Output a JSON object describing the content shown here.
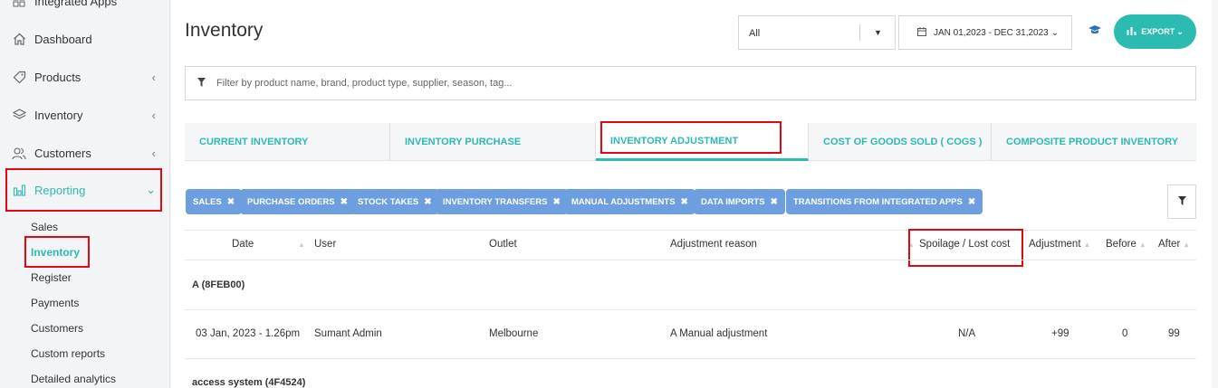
{
  "sidebar": {
    "items": [
      {
        "label": "Integrated Apps",
        "icon": "grid-icon"
      },
      {
        "label": "Dashboard",
        "icon": "home-icon"
      },
      {
        "label": "Products",
        "icon": "tag-icon"
      },
      {
        "label": "Inventory",
        "icon": "layers-icon"
      },
      {
        "label": "Customers",
        "icon": "users-icon"
      },
      {
        "label": "Reporting",
        "icon": "bar-chart-icon"
      }
    ],
    "reporting_sub": [
      "Sales",
      "Inventory",
      "Register",
      "Payments",
      "Customers",
      "Custom reports",
      "Detailed analytics"
    ]
  },
  "header": {
    "title": "Inventory",
    "outlet_select": "All",
    "date_range": "JAN 01,2023 - DEC 31,2023",
    "export_label": "EXPORT"
  },
  "filter": {
    "placeholder": "Filter by product name, brand, product type, supplier, season, tag..."
  },
  "tabs": [
    "CURRENT INVENTORY",
    "INVENTORY PURCHASE",
    "INVENTORY ADJUSTMENT",
    "COST OF GOODS SOLD ( COGS )",
    "COMPOSITE PRODUCT INVENTORY"
  ],
  "chips": [
    "SALES",
    "PURCHASE ORDERS",
    "STOCK TAKES",
    "INVENTORY TRANSFERS",
    "MANUAL ADJUSTMENTS",
    "DATA IMPORTS",
    "TRANSITIONS FROM INTEGRATED APPS"
  ],
  "table": {
    "columns": [
      "Date",
      "User",
      "Outlet",
      "Adjustment reason",
      "Spoilage / Lost cost",
      "Adjustment",
      "Before",
      "After"
    ],
    "groups": [
      {
        "name": "A (8FEB00)",
        "rows": [
          {
            "date": "03 Jan, 2023 - 1.26pm",
            "user": "Sumant Admin",
            "outlet": "Melbourne",
            "reason": "A Manual adjustment",
            "spoilage": "N/A",
            "adjustment": "+99",
            "before": "0",
            "after": "99"
          }
        ]
      },
      {
        "name": "access system (4F4524)",
        "rows": []
      }
    ]
  },
  "colors": {
    "accent": "#2bbbb0",
    "chip": "#6d9fe0",
    "highlight": "#e30613"
  }
}
